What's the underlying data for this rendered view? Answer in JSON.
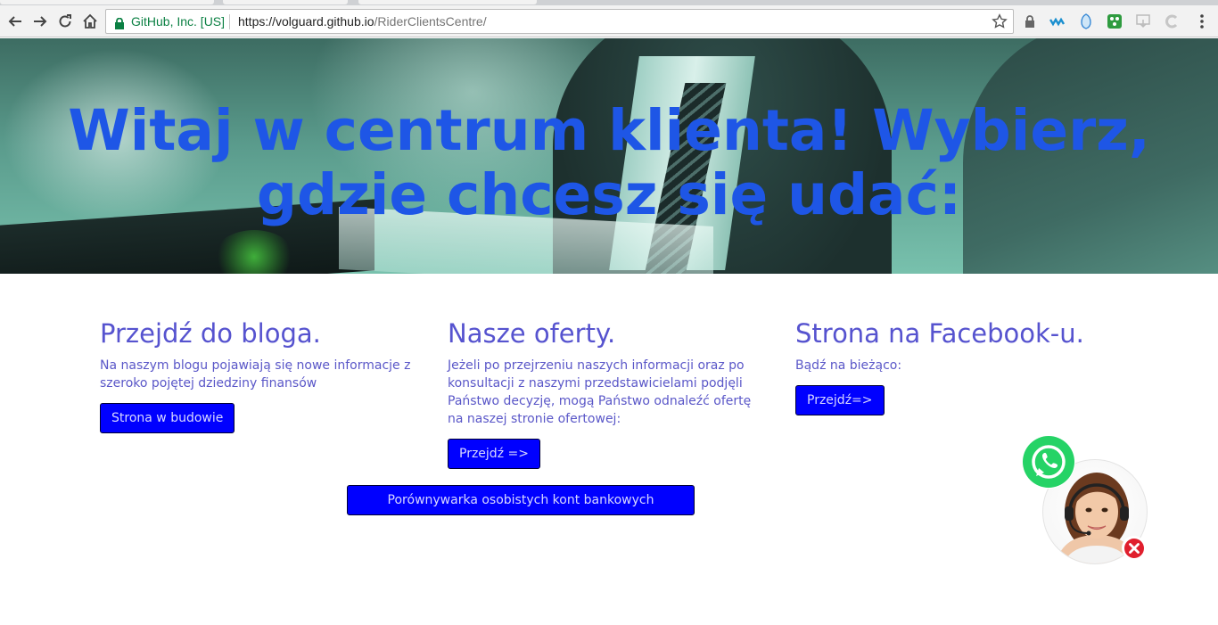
{
  "browser": {
    "secure_label": "GitHub, Inc. [US]",
    "url_host": "https://volguard.github.io",
    "url_path": "/RiderClientsCentre/",
    "icons": [
      "back-icon",
      "forward-icon",
      "reload-icon",
      "home-icon",
      "lock-icon",
      "star-icon"
    ],
    "extensions": [
      "lock-extension-icon",
      "wave-extension-icon",
      "shield-extension-icon",
      "green-extension-icon",
      "download-extension-icon",
      "c-extension-icon",
      "menu-icon"
    ]
  },
  "hero": {
    "title": "Witaj w centrum klienta! Wybierz, gdzie chcesz się udać:"
  },
  "columns": [
    {
      "heading": "Przejdź do bloga.",
      "text": "Na naszym blogu pojawiają się nowe informacje z szeroko pojętej dziedziny finansów",
      "button": "Strona w budowie"
    },
    {
      "heading": "Nasze oferty.",
      "text": "Jeżeli po przejrzeniu naszych informacji oraz po konsultacji z naszymi przedstawicielami podjęli Państwo decyzję, mogą Państwo odnaleźć ofertę na naszej stronie ofertowej:",
      "button": "Przejdź =>"
    },
    {
      "heading": "Strona na Facebook-u.",
      "text": "Bądź na bieżąco:",
      "button": "Przejdź=>"
    }
  ],
  "compare_button": "Porównywarka osobistych kont bankowych",
  "chat_widget": {
    "icons": [
      "whatsapp-icon",
      "support-agent-avatar",
      "close-icon"
    ],
    "colors": {
      "whatsapp": "#25d366",
      "close": "#e01f2d"
    }
  },
  "colors": {
    "hero_title": "#1e56e6",
    "heading": "#5653cf",
    "button_bg": "#0000ff"
  }
}
